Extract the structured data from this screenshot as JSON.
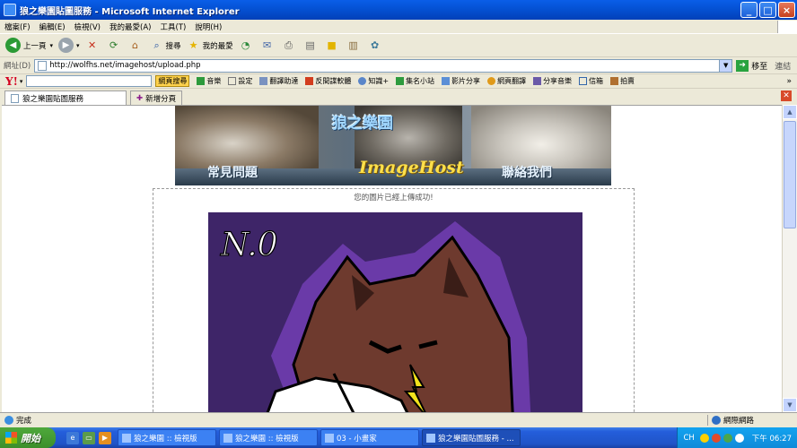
{
  "window": {
    "title": "狼之樂園貼圖服務 - Microsoft Internet Explorer",
    "min_glyph": "_",
    "max_glyph": "□",
    "close_glyph": "×"
  },
  "menu": [
    "檔案(F)",
    "編輯(E)",
    "檢視(V)",
    "我的最愛(A)",
    "工具(T)",
    "說明(H)"
  ],
  "toolbar": {
    "back_label": "上一頁",
    "search_label": "搜尋",
    "favorites_label": "我的最愛"
  },
  "address": {
    "label": "網址(D)",
    "url": "http://wolfhs.net/imagehost/upload.php",
    "go_label": "移至",
    "links_label": "連結"
  },
  "yahoo": {
    "logo": "Y!",
    "search_button": "網頁搜尋",
    "items": [
      "音樂",
      "設定",
      "翻譯助達",
      "反間諜軟體",
      "知識+",
      "集名小站",
      "影片分享",
      "網頁翻譯",
      "分享音樂",
      "信箱",
      "拍賣"
    ]
  },
  "tabs": {
    "active": "狼之樂園貼圖服務",
    "new_tab": "新增分頁"
  },
  "page": {
    "banner_title": "狼之樂園",
    "banner_faq": "常見問題",
    "banner_host": "ImageHost",
    "banner_contact": "聯絡我們",
    "success_message": "您的圖片已經上傳成功!",
    "art_text": "N.0"
  },
  "status": {
    "text": "完成",
    "zone": "網際網路"
  },
  "taskbar": {
    "start": "開始",
    "tasks": [
      "狼之樂園 :: 檢視版",
      "狼之樂園 :: 檢視版",
      "03 - 小畫家",
      "狼之樂園貼圖服務 - ..."
    ],
    "lang": "CH",
    "clock": "下午 06:27"
  },
  "colors": {
    "title_blue": "#0553d6",
    "art_background": "#3e2568",
    "art_halo": "#6a3aa8",
    "fur": "#6e3a2e"
  }
}
